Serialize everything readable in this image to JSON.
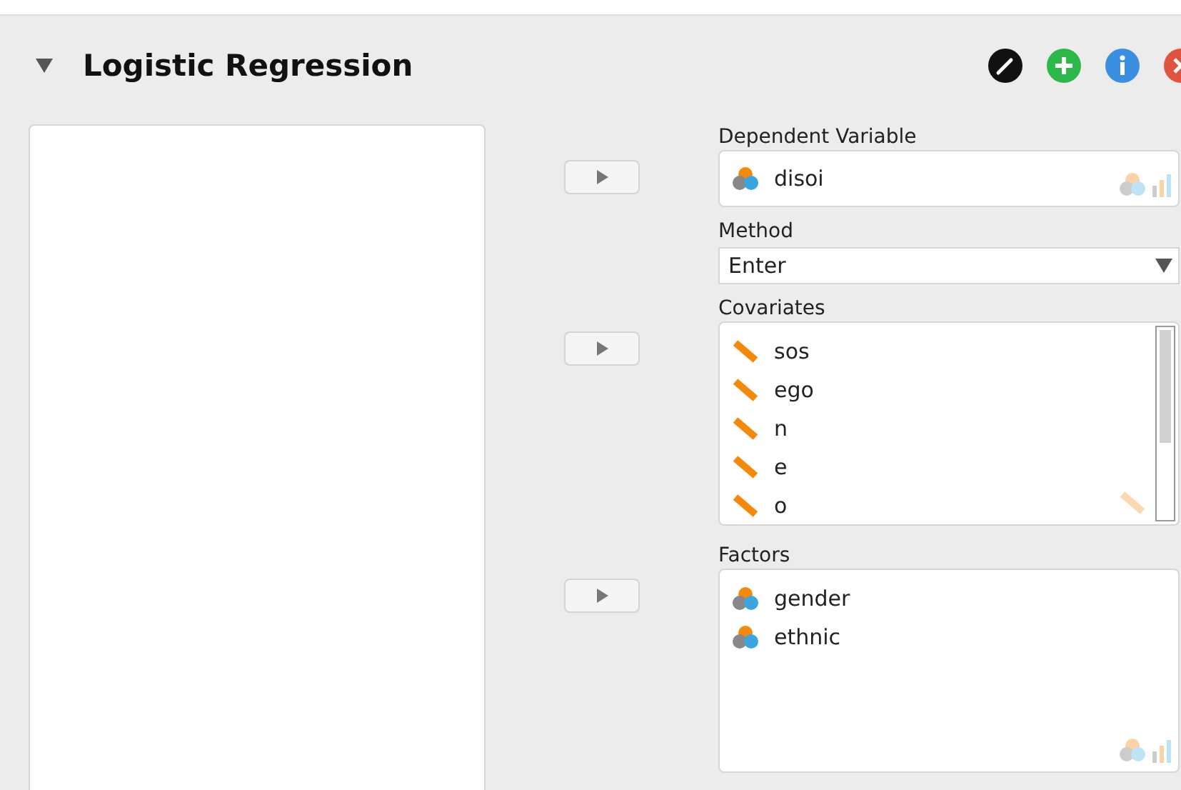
{
  "panel": {
    "title": "Logistic Regression",
    "expanded": true
  },
  "dependent": {
    "label": "Dependent Variable",
    "items": [
      {
        "name": "disoi",
        "kind": "nominal"
      }
    ]
  },
  "method": {
    "label": "Method",
    "value": "Enter"
  },
  "covariates": {
    "label": "Covariates",
    "items": [
      {
        "name": "sos",
        "kind": "scale"
      },
      {
        "name": "ego",
        "kind": "scale"
      },
      {
        "name": "n",
        "kind": "scale"
      },
      {
        "name": "e",
        "kind": "scale"
      },
      {
        "name": "o",
        "kind": "scale"
      }
    ]
  },
  "factors": {
    "label": "Factors",
    "items": [
      {
        "name": "gender",
        "kind": "nominal"
      },
      {
        "name": "ethnic",
        "kind": "nominal"
      }
    ]
  }
}
